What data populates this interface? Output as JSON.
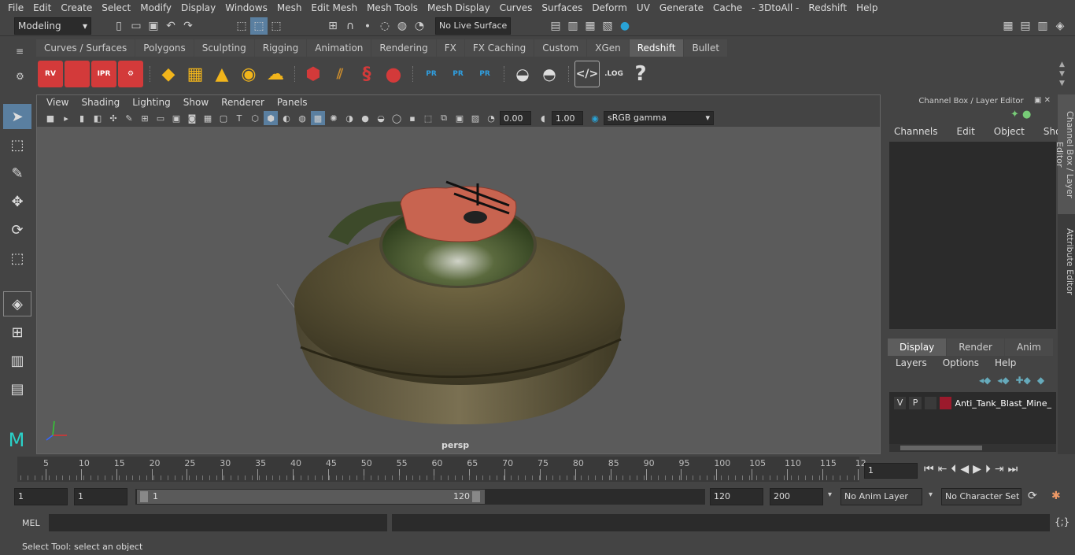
{
  "menu": [
    "File",
    "Edit",
    "Create",
    "Select",
    "Modify",
    "Display",
    "Windows",
    "Mesh",
    "Edit Mesh",
    "Mesh Tools",
    "Mesh Display",
    "Curves",
    "Surfaces",
    "Deform",
    "UV",
    "Generate",
    "Cache",
    "- 3DtoAll -",
    "Redshift",
    "Help"
  ],
  "status": {
    "mode": "Modeling",
    "live_surface": "No Live Surface"
  },
  "shelf_tabs": [
    "Curves / Surfaces",
    "Polygons",
    "Sculpting",
    "Rigging",
    "Animation",
    "Rendering",
    "FX",
    "FX Caching",
    "Custom",
    "XGen",
    "Redshift",
    "Bullet"
  ],
  "active_shelf": "Redshift",
  "shelf_icons": {
    "rv": "RV",
    "ipr": "IPR",
    "pr": "PR",
    "log": ".LOG",
    "help": "?"
  },
  "viewport": {
    "menu": [
      "View",
      "Shading",
      "Lighting",
      "Show",
      "Renderer",
      "Panels"
    ],
    "exposure": "0.00",
    "gamma": "1.00",
    "colorspace": "sRGB gamma",
    "camera": "persp"
  },
  "channel_box": {
    "title": "Channel Box / Layer Editor",
    "menu": [
      "Channels",
      "Edit",
      "Object",
      "Show"
    ]
  },
  "layer_editor": {
    "tabs": [
      "Display",
      "Render",
      "Anim"
    ],
    "active": "Display",
    "menu": [
      "Layers",
      "Options",
      "Help"
    ],
    "layers": [
      {
        "v": "V",
        "p": "P",
        "name": "Anti_Tank_Blast_Mine_",
        "color": "#9b1a2c"
      }
    ]
  },
  "side_tabs": [
    "Channel Box / Layer Editor",
    "Attribute Editor"
  ],
  "timeline": {
    "labels": [
      "5",
      "10",
      "15",
      "20",
      "25",
      "30",
      "35",
      "40",
      "45",
      "50",
      "55",
      "60",
      "65",
      "70",
      "75",
      "80",
      "85",
      "90",
      "95",
      "100",
      "105",
      "110",
      "115",
      "12"
    ],
    "start_label": "1",
    "current_frame": "1"
  },
  "range": {
    "start": "1",
    "playback_start": "1",
    "slider_start": "1",
    "slider_end": "120",
    "end": "120",
    "total_end": "200",
    "anim_layer": "No Anim Layer",
    "char_set": "No Character Set"
  },
  "cmd": {
    "lang": "MEL"
  },
  "help_text": "Select Tool: select an object"
}
